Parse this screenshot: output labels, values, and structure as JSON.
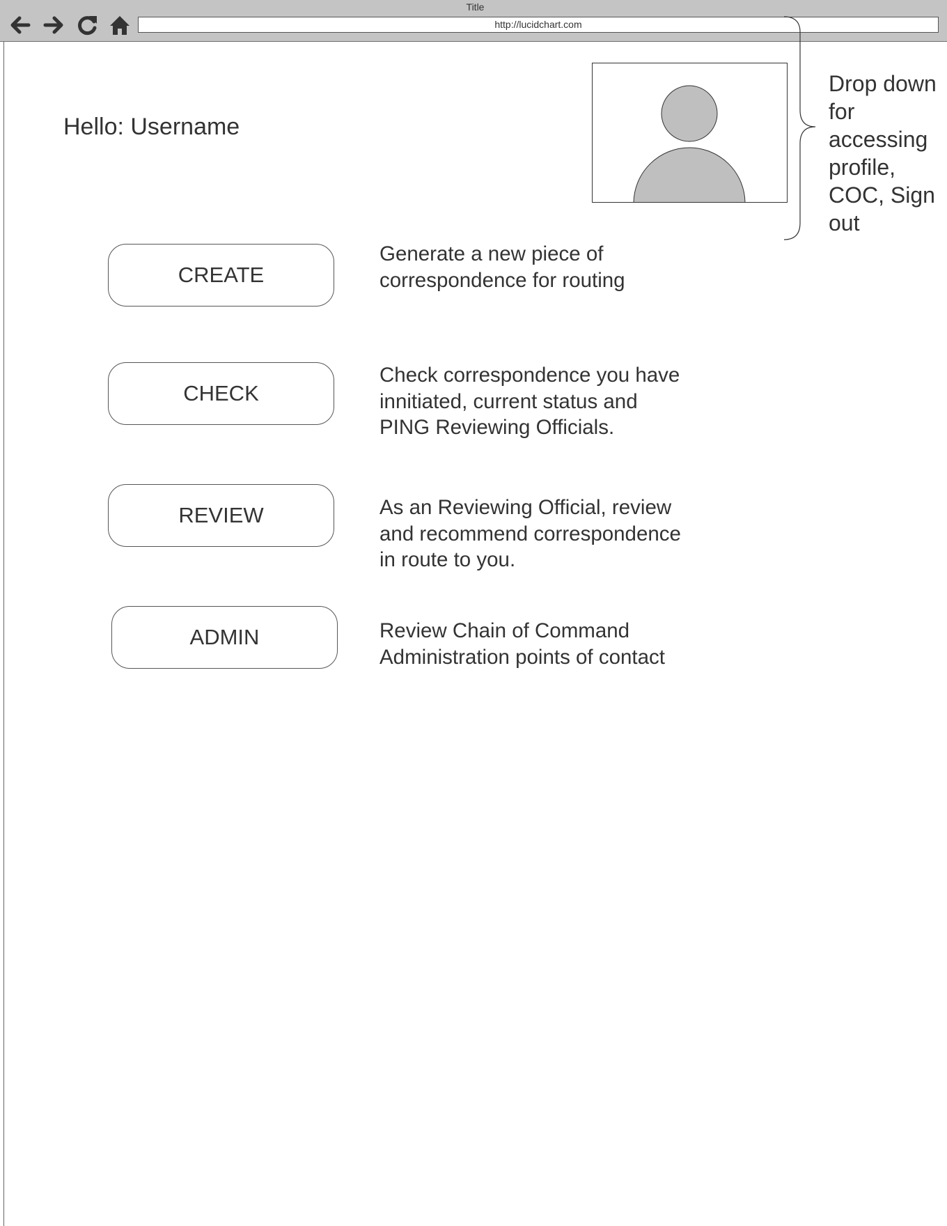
{
  "window": {
    "title": "Title",
    "url": "http://lucidchart.com"
  },
  "nav": {
    "back_icon": "arrow-left-icon",
    "forward_icon": "arrow-right-icon",
    "refresh_icon": "refresh-icon",
    "home_icon": "home-icon"
  },
  "greeting": "Hello: Username",
  "profile": {
    "avatar_icon": "user-avatar-icon",
    "annotation": "Drop down for accessing profile, COC, Sign out"
  },
  "actions": [
    {
      "label": "CREATE",
      "description": "Generate a new piece of correspondence for routing"
    },
    {
      "label": "CHECK",
      "description": "Check correspondence you have innitiated, current status and PING Reviewing Officials."
    },
    {
      "label": "REVIEW",
      "description": "As an Reviewing Official, review and recommend correspondence in route to you."
    },
    {
      "label": "ADMIN",
      "description": "Review Chain of Command Administration points of contact"
    }
  ],
  "colors": {
    "chrome": "#c4c4c4",
    "avatar_fill": "#bfbfbf",
    "text": "#333333"
  }
}
